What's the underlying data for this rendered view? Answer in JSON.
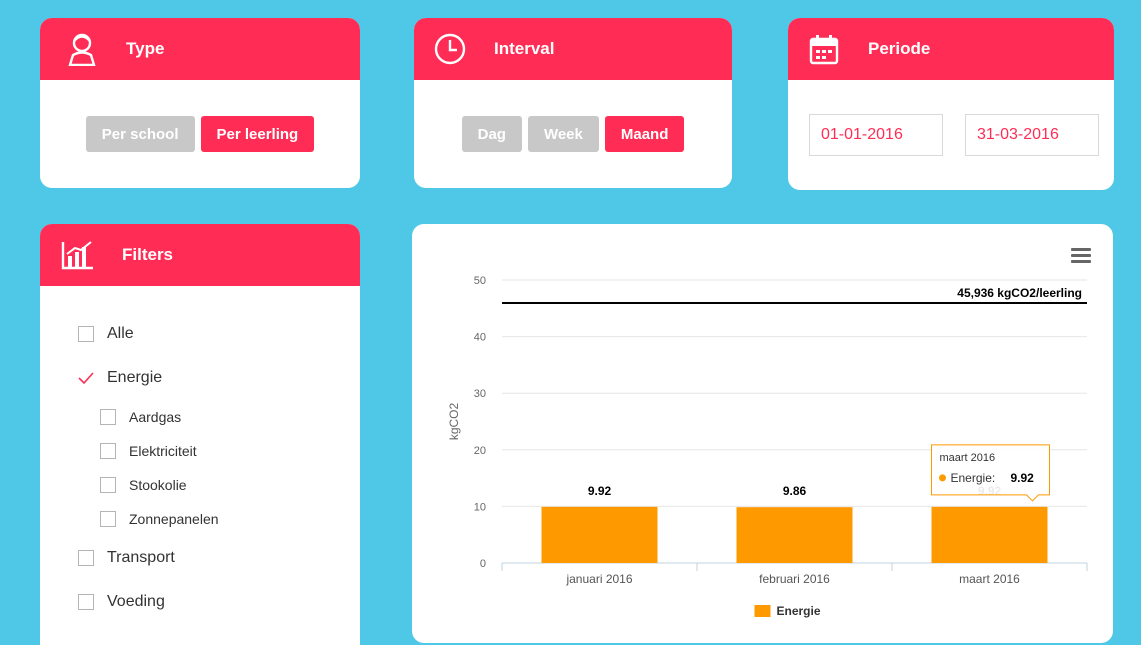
{
  "type_card": {
    "title": "Type",
    "icon": "person-icon",
    "buttons": [
      {
        "label": "Per school",
        "active": false
      },
      {
        "label": "Per leerling",
        "active": true
      }
    ]
  },
  "interval_card": {
    "title": "Interval",
    "icon": "clock-icon",
    "buttons": [
      {
        "label": "Dag",
        "active": false
      },
      {
        "label": "Week",
        "active": false
      },
      {
        "label": "Maand",
        "active": true
      }
    ]
  },
  "periode_card": {
    "title": "Periode",
    "icon": "calendar-icon",
    "start_date": "01-01-2016",
    "end_date": "31-03-2016"
  },
  "filters_card": {
    "title": "Filters",
    "icon": "bar-chart-icon",
    "items": [
      {
        "label": "Alle",
        "checked": false
      },
      {
        "label": "Energie",
        "checked": true
      },
      {
        "label": "Aardgas",
        "checked": false
      },
      {
        "label": "Elektriciteit",
        "checked": false
      },
      {
        "label": "Stookolie",
        "checked": false
      },
      {
        "label": "Zonnepanelen",
        "checked": false
      },
      {
        "label": "Transport",
        "checked": false
      },
      {
        "label": "Voeding",
        "checked": false
      }
    ]
  },
  "colors": {
    "accent": "#ff2d55",
    "background": "#4fc8e8",
    "bar": "#ff9900",
    "inactive_button": "#c8c8c8"
  },
  "chart_data": {
    "type": "bar",
    "categories": [
      "januari 2016",
      "februari 2016",
      "maart 2016"
    ],
    "series": [
      {
        "name": "Energie",
        "values": [
          9.92,
          9.86,
          9.92
        ]
      }
    ],
    "data_labels": [
      "9.92",
      "9.86",
      "9.92"
    ],
    "ylabel": "kgCO2",
    "xlabel": "",
    "ylim": [
      0,
      50
    ],
    "yticks": [
      0,
      10,
      20,
      30,
      40,
      50
    ],
    "grid": true,
    "legend": "bottom-center",
    "reference_line": {
      "value": 45.936,
      "label": "45,936 kgCO2/leerling"
    },
    "tooltip": {
      "title": "maart 2016",
      "series": "Energie",
      "value": "9.92"
    }
  }
}
